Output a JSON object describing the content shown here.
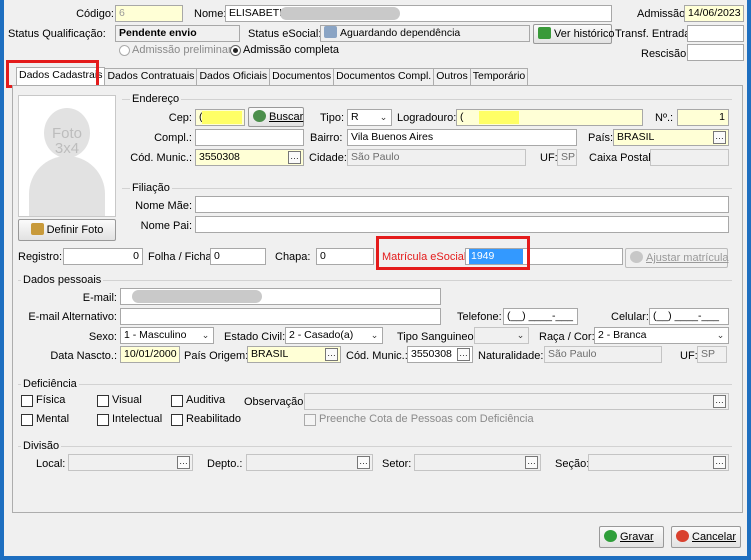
{
  "header": {
    "codigo_label": "Código:",
    "codigo_value": "6",
    "nome_label": "Nome:",
    "nome_value": "ELISABETH",
    "admissao_label": "Admissão:",
    "admissao_value": "14/06/2023",
    "status_qual_label": "Status Qualificação:",
    "status_qual_value": "Pendente envio",
    "status_esocial_label": "Status eSocial:",
    "status_esocial_value": "Aguardando dependência",
    "ver_historico": "Ver histórico",
    "transf_label": "Transf. Entrada:",
    "rescisao_label": "Rescisão:",
    "admissao_preliminar": "Admissão preliminar",
    "admissao_completa": "Admissão completa"
  },
  "tabs": [
    "Dados Cadastrais",
    "Dados Contratuais",
    "Dados Oficiais",
    "Documentos",
    "Documentos Compl.",
    "Outros",
    "Temporário"
  ],
  "photo": {
    "placeholder_line1": "Foto",
    "placeholder_line2": "3x4",
    "definir_foto": "Definir Foto"
  },
  "endereco": {
    "title": "Endereço",
    "cep_label": "Cep:",
    "cep_value": "(",
    "buscar": "Buscar",
    "tipo_label": "Tipo:",
    "tipo_value": "R",
    "logradouro_label": "Logradouro:",
    "logradouro_value": "(",
    "numero_label": "Nº.:",
    "numero_value": "1",
    "compl_label": "Compl.:",
    "compl_value": "",
    "bairro_label": "Bairro:",
    "bairro_value": "Vila Buenos Aires",
    "pais_label": "País:",
    "pais_value": "BRASIL",
    "cod_munic_label": "Cód. Munic.:",
    "cod_munic_value": "3550308",
    "cidade_label": "Cidade:",
    "cidade_value": "São Paulo",
    "uf_label": "UF:",
    "uf_value": "SP",
    "caixa_postal_label": "Caixa Postal:",
    "caixa_postal_value": ""
  },
  "filiacao": {
    "title": "Filiação",
    "nome_mae_label": "Nome Mãe:",
    "nome_pai_label": "Nome Pai:"
  },
  "registro": {
    "registro_label": "Registro:",
    "registro_value": "0",
    "folha_label": "Folha / Ficha:",
    "folha_value": "0",
    "chapa_label": "Chapa:",
    "chapa_value": "0",
    "matricula_label": "Matrícula eSocial:",
    "matricula_value": "1949",
    "ajustar": "Ajustar matrícula"
  },
  "pessoais": {
    "title": "Dados pessoais",
    "email_label": "E-mail:",
    "email_alt_label": "E-mail Alternativo:",
    "telefone_label": "Telefone:",
    "telefone_value": "(__) ____-___",
    "celular_label": "Celular:",
    "celular_value": "(__) ____-___",
    "sexo_label": "Sexo:",
    "sexo_value": "1 - Masculino",
    "estado_civil_label": "Estado Civil:",
    "estado_civil_value": "2 - Casado(a)",
    "tipo_sang_label": "Tipo Sanguineo:",
    "raca_label": "Raça / Cor:",
    "raca_value": "2 - Branca",
    "nascto_label": "Data Nascto.:",
    "nascto_value": "10/01/2000",
    "pais_origem_label": "País Origem:",
    "pais_origem_value": "BRASIL",
    "cod_munic_label": "Cód. Munic.:",
    "cod_munic_value": "3550308",
    "naturalidade_label": "Naturalidade:",
    "naturalidade_value": "São Paulo",
    "uf_label": "UF:",
    "uf_value": "SP"
  },
  "deficiencia": {
    "title": "Deficiência",
    "fisica": "Física",
    "visual": "Visual",
    "auditiva": "Auditiva",
    "observacao_label": "Observação:",
    "mental": "Mental",
    "intelectual": "Intelectual",
    "reabilitado": "Reabilitado",
    "preenche_cota": "Preenche Cota de Pessoas com Deficiência"
  },
  "divisao": {
    "title": "Divisão",
    "local_label": "Local:",
    "depto_label": "Depto.:",
    "setor_label": "Setor:",
    "secao_label": "Seção:"
  },
  "footer": {
    "gravar": "Gravar",
    "cancelar": "Cancelar"
  },
  "colors": {
    "yellow_field": "#ffffd6",
    "highlight_red": "#e41b1b",
    "selection_blue": "#3399ff"
  }
}
